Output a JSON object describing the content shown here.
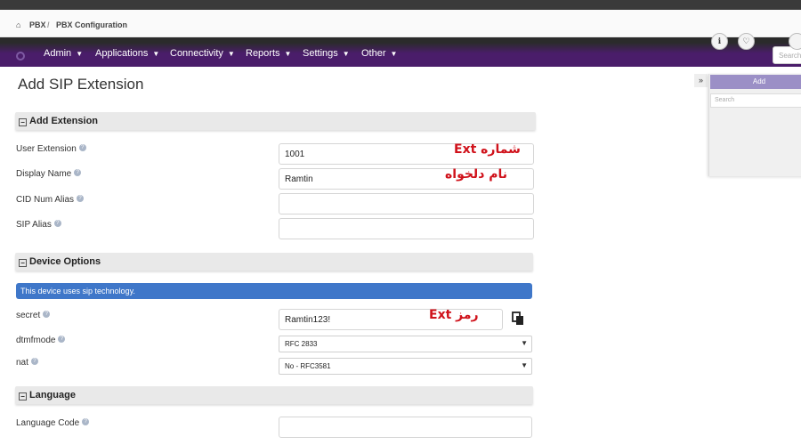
{
  "breadcrumb": {
    "home_icon": "home-icon",
    "item1": "PBX",
    "separator": "/",
    "item2": "PBX Configuration"
  },
  "nav": {
    "items": [
      "Admin",
      "Applications",
      "Connectivity",
      "Reports",
      "Settings",
      "Other"
    ],
    "search_placeholder": "Search"
  },
  "page_title": "Add SIP Extension",
  "sections": {
    "add_extension": "Add Extension",
    "device_options": "Device Options",
    "language": "Language"
  },
  "fields": {
    "user_extension": {
      "label": "User Extension",
      "value": "1001"
    },
    "display_name": {
      "label": "Display Name",
      "value": "Ramtin"
    },
    "cid_num_alias": {
      "label": "CID Num Alias",
      "value": ""
    },
    "sip_alias": {
      "label": "SIP Alias",
      "value": ""
    },
    "secret": {
      "label": "secret",
      "value": "Ramtin123!"
    },
    "dtmfmode": {
      "label": "dtmfmode",
      "value": "RFC 2833"
    },
    "nat": {
      "label": "nat",
      "value": "No - RFC3581"
    },
    "language_code": {
      "label": "Language Code",
      "value": ""
    }
  },
  "info_bar": "This device uses sip technology.",
  "annotations": {
    "ext_number": "شماره Ext",
    "display_name": "نام دلخواه",
    "password": "رمز Ext"
  },
  "side_panel": {
    "toggle": "»",
    "add_label": "Add",
    "search_placeholder": "Search"
  },
  "colors": {
    "nav_bg": "#4a1d6a",
    "info_bg": "#3f77c9",
    "annotation": "#d0121b"
  }
}
